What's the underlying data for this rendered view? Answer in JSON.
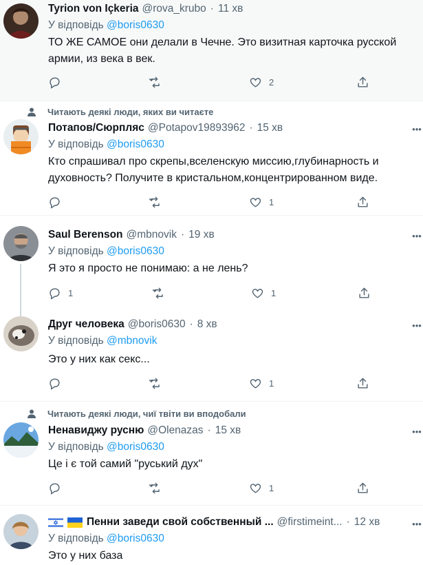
{
  "tweets": [
    {
      "name": "Tyrion von Içkeria",
      "handle": "@rova_krubo",
      "time": "11 хв",
      "reply_prefix": "У відповідь",
      "reply_to": "@boris0630",
      "text": "ТО ЖЕ САМОЕ они делали в Чечне. Это визитная карточка русской армии, из века в век.",
      "likes": "2",
      "retweets": "",
      "replies": ""
    },
    {
      "social_context": "Читають деякі люди, яких ви читаєте",
      "name": "Потапов/Сюрпляс",
      "handle": "@Potapov19893962",
      "time": "15 хв",
      "reply_prefix": "У відповідь",
      "reply_to": "@boris0630",
      "text": "Кто спрашивал про скрепы,вселенскую миссию,глубинарность и духовность? Получите в кристальном,концентрированном виде.",
      "likes": "1",
      "retweets": "",
      "replies": ""
    },
    {
      "name": "Saul Berenson",
      "handle": "@mbnovik",
      "time": "19 хв",
      "reply_prefix": "У відповідь",
      "reply_to": "@boris0630",
      "text": "Я это я просто не понимаю: а не лень?",
      "likes": "1",
      "retweets": "",
      "replies": "1"
    },
    {
      "name": "Друг человека",
      "handle": "@boris0630",
      "time": "8 хв",
      "reply_prefix": "У відповідь",
      "reply_to": "@mbnovik",
      "text": "Это у них как секс...",
      "likes": "1",
      "retweets": "",
      "replies": ""
    },
    {
      "social_context": "Читають деякі люди, чиї твіти ви вподобали",
      "name": "Ненавиджу русню",
      "handle": "@Olenazas",
      "time": "15 хв",
      "reply_prefix": "У відповідь",
      "reply_to": "@boris0630",
      "text": "Це і є той самий \"руський дух\"",
      "likes": "1",
      "retweets": "",
      "replies": ""
    },
    {
      "name": "Пенни заведи свой собственный ...",
      "handle": "@firstimeint...",
      "time": "12 хв",
      "reply_prefix": "У відповідь",
      "reply_to": "@boris0630",
      "text": "Это у них база"
    }
  ],
  "separator": "·",
  "icons": [
    "reply-icon",
    "retweet-icon",
    "like-icon",
    "share-icon",
    "more-icon",
    "person-icon"
  ],
  "colors": {
    "mention": "#1d9bf0",
    "secondary": "#536471",
    "highlight_bg": "#f7f9f9",
    "divider": "#eff3f4"
  }
}
